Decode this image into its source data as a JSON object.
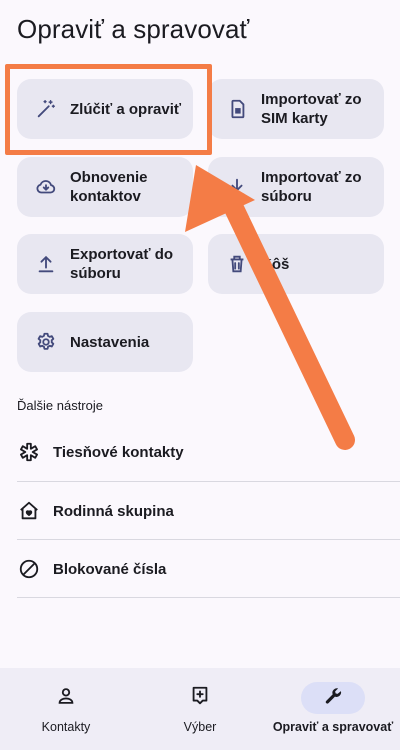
{
  "header": {
    "title": "Opraviť a spravovať"
  },
  "cards": [
    {
      "label": "Zlúčiť a opraviť",
      "icon": "magic-wand-icon"
    },
    {
      "label": "Importovať zo SIM karty",
      "icon": "sim-card-icon"
    },
    {
      "label": "Obnovenie kontaktov",
      "icon": "cloud-download-icon"
    },
    {
      "label": "Importovať zo súboru",
      "icon": "download-icon"
    },
    {
      "label": "Exportovať do súboru",
      "icon": "upload-icon"
    },
    {
      "label": "Kôš",
      "icon": "trash-icon"
    },
    {
      "label": "Nastavenia",
      "icon": "gear-icon"
    }
  ],
  "tools": {
    "title": "Ďalšie nástroje",
    "items": [
      {
        "label": "Tiesňové kontakty",
        "icon": "emergency-icon"
      },
      {
        "label": "Rodinná skupina",
        "icon": "family-home-icon"
      },
      {
        "label": "Blokované čísla",
        "icon": "block-icon"
      }
    ]
  },
  "nav": {
    "items": [
      {
        "label": "Kontakty",
        "icon": "person-icon"
      },
      {
        "label": "Výber",
        "icon": "add-box-icon"
      },
      {
        "label": "Opraviť a spravovať",
        "icon": "wrench-icon",
        "active": true
      }
    ]
  },
  "colors": {
    "accent": "#434a7c",
    "annotation": "#f47c46",
    "card_bg": "#e8e7f1",
    "active_pill": "#dcdff7"
  }
}
